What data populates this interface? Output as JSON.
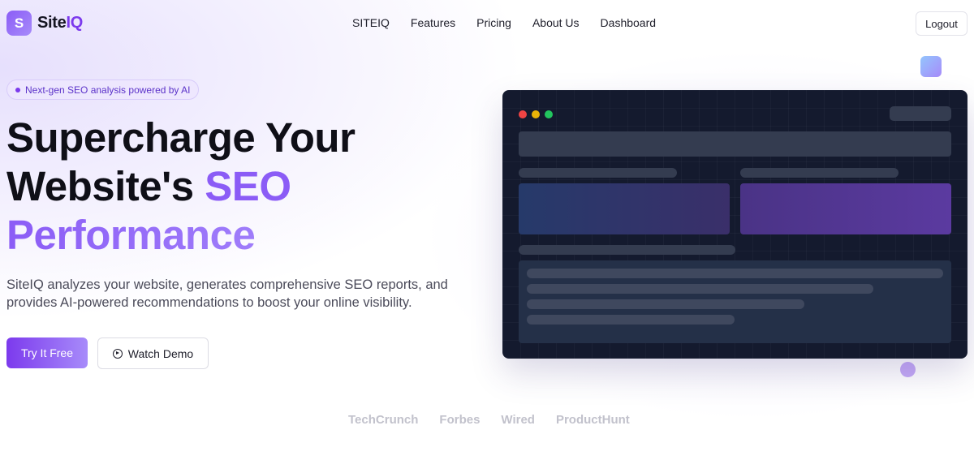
{
  "brand": {
    "mark": "S",
    "name_part1": "Site",
    "name_part2": "IQ"
  },
  "nav": {
    "links": [
      "SITEIQ",
      "Features",
      "Pricing",
      "About Us",
      "Dashboard"
    ],
    "logout_label": "Logout"
  },
  "hero": {
    "badge": "Next-gen SEO analysis powered by AI",
    "headline_line1": "Supercharge Your",
    "headline_line2_a": "Website's ",
    "headline_line2_b": "SEO",
    "headline_line3": "Performance",
    "subtext": "SiteIQ analyzes your website, generates comprehensive SEO reports, and provides AI-powered recommendations to boost your online visibility.",
    "primary_cta": "Try It Free",
    "secondary_cta": "Watch Demo",
    "secondary_icon": "play-circle-icon"
  },
  "press": [
    "TechCrunch",
    "Forbes",
    "Wired",
    "ProductHunt"
  ],
  "colors": {
    "accent": "#7c3aed",
    "accent_light": "#a78bfa",
    "mock_bg": "#141a2e",
    "window_red": "#ef4444",
    "window_yellow": "#eab308",
    "window_green": "#22c55e"
  }
}
